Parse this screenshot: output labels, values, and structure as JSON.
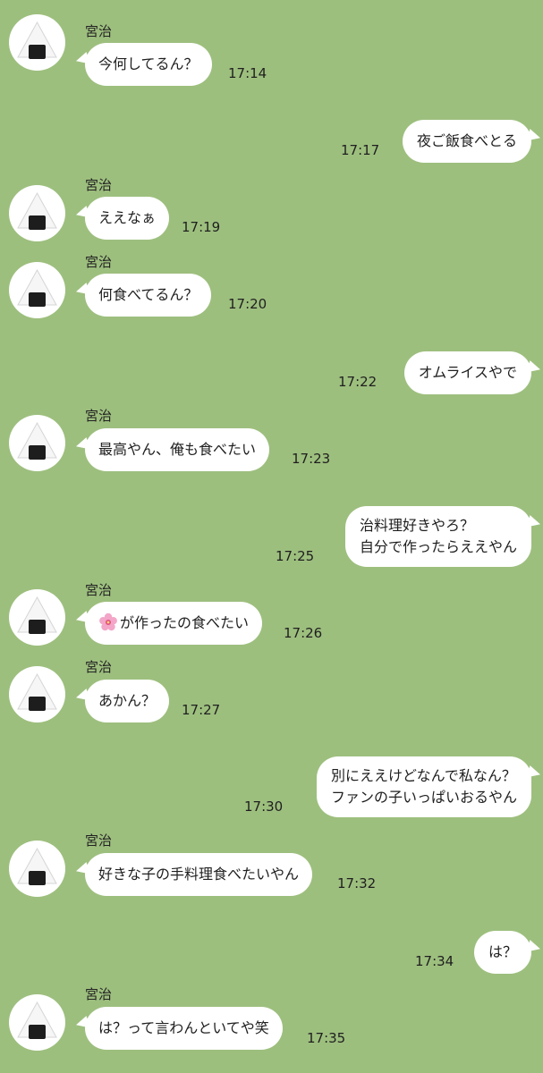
{
  "contact": {
    "name": "宮治",
    "avatar_icon": "onigiri-icon"
  },
  "colors": {
    "background": "#9dbf7e",
    "bubble": "#ffffff"
  },
  "messages": [
    {
      "from": "them",
      "text": "今何してるん？",
      "time": "17:14"
    },
    {
      "from": "me",
      "text": "夜ご飯食べとる",
      "time": "17:17"
    },
    {
      "from": "them",
      "text": "ええなぁ",
      "time": "17:19"
    },
    {
      "from": "them",
      "text": "何食べてるん？",
      "time": "17:20"
    },
    {
      "from": "me",
      "text": "オムライスやで",
      "time": "17:22"
    },
    {
      "from": "them",
      "text": "最高やん、俺も食べたい",
      "time": "17:23"
    },
    {
      "from": "me",
      "lines": [
        "治料理好きやろ？",
        "自分で作ったらええやん"
      ],
      "time": "17:25"
    },
    {
      "from": "them",
      "icon": "flower-icon",
      "text": "が作ったの食べたい",
      "time": "17:26"
    },
    {
      "from": "them",
      "text": "あかん？",
      "time": "17:27"
    },
    {
      "from": "me",
      "lines": [
        "別にええけどなんで私なん？",
        "ファンの子いっぱいおるやん"
      ],
      "time": "17:30"
    },
    {
      "from": "them",
      "text": "好きな子の手料理食べたいやん",
      "time": "17:32"
    },
    {
      "from": "me",
      "text": "は？",
      "time": "17:34"
    },
    {
      "from": "them",
      "text": "は？って言わんといてや笑",
      "time": "17:35"
    }
  ]
}
